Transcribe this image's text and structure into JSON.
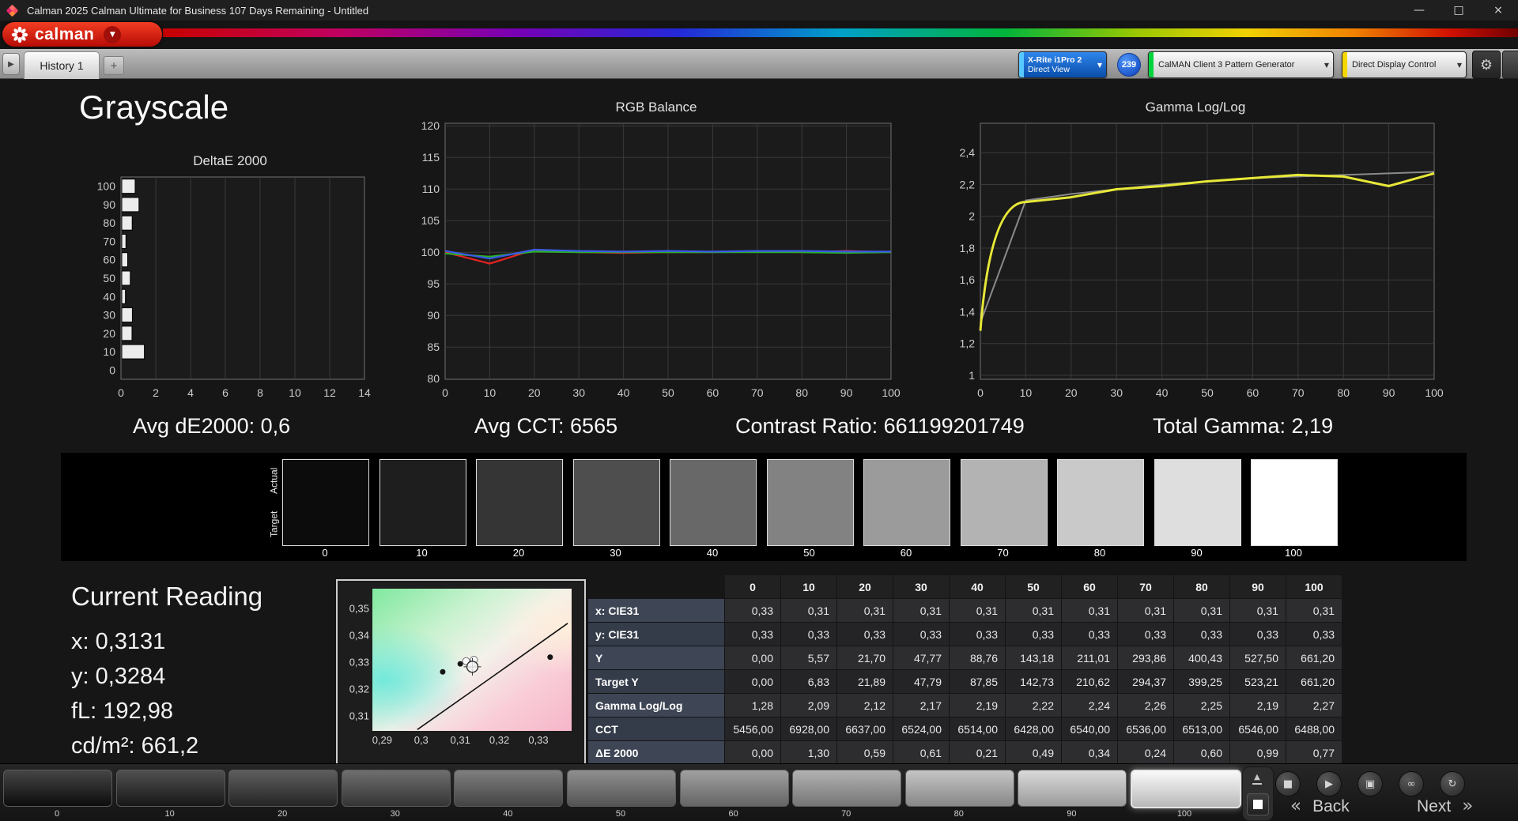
{
  "titlebar": {
    "title": "Calman 2025 Calman Ultimate for Business 107 Days Remaining  - Untitled"
  },
  "ui": {
    "minimize": "—",
    "maximize": "□",
    "close": "×",
    "dropdown_arrow": "▼",
    "nav_arrow": "▶",
    "gear": "⚙",
    "eject": "▲",
    "back_arrow": "«",
    "next_arrow": "»"
  },
  "logo": {
    "brand": "calman"
  },
  "tabbar": {
    "history_tab": "History 1",
    "add_tab": "+",
    "meter_button": {
      "line1": "X-Rite i1Pro 2",
      "line2": "Direct View"
    },
    "meter_badge": "239",
    "pattern_button": "CalMAN Client 3 Pattern Generator",
    "display_button": "Direct Display Control"
  },
  "page": {
    "title": "Grayscale"
  },
  "stats": [
    "Avg dE2000: 0,6",
    "Avg CCT: 6565",
    "Contrast Ratio: 661199201749",
    "Total Gamma: 2,19"
  ],
  "chart_data": [
    {
      "type": "bar",
      "orientation": "horizontal",
      "title": "DeltaE 2000",
      "categories": [
        "100",
        "90",
        "80",
        "70",
        "60",
        "50",
        "40",
        "30",
        "20",
        "10",
        "0"
      ],
      "values": [
        0.77,
        0.99,
        0.6,
        0.24,
        0.34,
        0.49,
        0.21,
        0.61,
        0.59,
        1.3,
        0.0
      ],
      "xlim": [
        0,
        14
      ],
      "xticks": [
        0,
        2,
        4,
        6,
        8,
        10,
        12,
        14
      ],
      "bar_color": "#ececec",
      "grid": true,
      "legend": "none"
    },
    {
      "type": "line",
      "title": "RGB Balance",
      "x": [
        0,
        10,
        20,
        30,
        40,
        50,
        60,
        70,
        80,
        90,
        100
      ],
      "xticks": [
        0,
        10,
        20,
        30,
        40,
        50,
        60,
        70,
        80,
        90,
        100
      ],
      "ylim": [
        79.9,
        120.4
      ],
      "yticks": [
        80,
        85,
        90,
        95,
        100,
        105,
        110,
        115,
        120
      ],
      "grid": true,
      "legend": "none",
      "series": [
        {
          "name": "red-balance",
          "color": "#e82222",
          "width": 2.2,
          "values": [
            100,
            98.2,
            100.4,
            100,
            99.9,
            100,
            100,
            100.1,
            100,
            100.2,
            100
          ]
        },
        {
          "name": "green-balance",
          "color": "#28b028",
          "width": 2.2,
          "values": [
            99.8,
            99.3,
            100.1,
            100,
            100,
            100,
            100,
            100,
            100,
            99.9,
            100
          ]
        },
        {
          "name": "blue-balance",
          "color": "#3a5ae8",
          "width": 2.2,
          "values": [
            100.2,
            99.0,
            100.4,
            100.2,
            100.1,
            100.2,
            100.1,
            100.2,
            100.2,
            100.1,
            100.1
          ]
        }
      ]
    },
    {
      "type": "line",
      "title": "Gamma Log/Log",
      "x": [
        0,
        10,
        20,
        30,
        40,
        50,
        60,
        70,
        80,
        90,
        100
      ],
      "xticks": [
        0,
        10,
        20,
        30,
        40,
        50,
        60,
        70,
        80,
        90,
        100
      ],
      "ylim": [
        0.975,
        2.585
      ],
      "yticks": [
        1,
        1.2,
        1.4,
        1.6,
        1.8,
        2,
        2.2,
        2.4
      ],
      "ytick_labels": [
        "1",
        "1,2",
        "1,4",
        "1,6",
        "1,8",
        "2",
        "2,2",
        "2,4"
      ],
      "grid": true,
      "legend": "none",
      "series": [
        {
          "name": "gamma-reference",
          "color": "#8a8a8a",
          "width": 2,
          "values": [
            1.33,
            2.1,
            2.14,
            2.17,
            2.2,
            2.22,
            2.24,
            2.25,
            2.26,
            2.27,
            2.28
          ]
        },
        {
          "name": "gamma-measured",
          "color": "#e8e838",
          "width": 3,
          "knee": true,
          "values": [
            1.28,
            2.09,
            2.12,
            2.17,
            2.19,
            2.22,
            2.24,
            2.26,
            2.25,
            2.19,
            2.27
          ]
        }
      ]
    }
  ],
  "swatch_strip": {
    "actual_label": "Actual",
    "target_label": "Target",
    "levels": [
      "0",
      "10",
      "20",
      "30",
      "40",
      "50",
      "60",
      "70",
      "80",
      "90",
      "100"
    ],
    "colors": [
      "#0c0c0c",
      "#1e1e1e",
      "#353535",
      "#4e4e4e",
      "#686868",
      "#828282",
      "#9b9b9b",
      "#b3b3b3",
      "#c9c9c9",
      "#dedede",
      "#ffffff"
    ]
  },
  "current_reading": {
    "title": "Current Reading",
    "lines": [
      "x: 0,3131",
      "y: 0,3284",
      "fL: 192,98",
      "cd/m²: 661,2"
    ]
  },
  "cie": {
    "xlim": [
      0.2875,
      0.3385
    ],
    "ylim": [
      0.3045,
      0.3575
    ],
    "xticks": [
      "0,29",
      "0,3",
      "0,31",
      "0,32",
      "0,33"
    ],
    "xtick_vals": [
      0.29,
      0.3,
      0.31,
      0.32,
      0.33
    ],
    "yticks": [
      "0,35",
      "0,34",
      "0,33",
      "0,32",
      "0,31"
    ],
    "ytick_vals": [
      0.35,
      0.34,
      0.33,
      0.32,
      0.31
    ],
    "locus": [
      [
        0.299,
        0.305
      ],
      [
        0.3157,
        0.3221
      ],
      [
        0.3375,
        0.3446
      ]
    ],
    "measured_points": [
      [
        0.3055,
        0.3265
      ],
      [
        0.31,
        0.3295
      ],
      [
        0.3125,
        0.33
      ],
      [
        0.333,
        0.332
      ]
    ],
    "target_points": [
      [
        0.3115,
        0.3305
      ],
      [
        0.3135,
        0.331
      ],
      [
        0.3128,
        0.3292
      ]
    ],
    "current_point": [
      0.3131,
      0.3284
    ]
  },
  "table": {
    "columns": [
      "",
      "0",
      "10",
      "20",
      "30",
      "40",
      "50",
      "60",
      "70",
      "80",
      "90",
      "100"
    ],
    "rows": [
      {
        "label": "x: CIE31",
        "values": [
          "0,33",
          "0,31",
          "0,31",
          "0,31",
          "0,31",
          "0,31",
          "0,31",
          "0,31",
          "0,31",
          "0,31",
          "0,31"
        ]
      },
      {
        "label": "y: CIE31",
        "values": [
          "0,33",
          "0,33",
          "0,33",
          "0,33",
          "0,33",
          "0,33",
          "0,33",
          "0,33",
          "0,33",
          "0,33",
          "0,33"
        ]
      },
      {
        "label": "Y",
        "values": [
          "0,00",
          "5,57",
          "21,70",
          "47,77",
          "88,76",
          "143,18",
          "211,01",
          "293,86",
          "400,43",
          "527,50",
          "661,20"
        ]
      },
      {
        "label": "Target Y",
        "values": [
          "0,00",
          "6,83",
          "21,89",
          "47,79",
          "87,85",
          "142,73",
          "210,62",
          "294,37",
          "399,25",
          "523,21",
          "661,20"
        ]
      },
      {
        "label": "Gamma Log/Log",
        "values": [
          "1,28",
          "2,09",
          "2,12",
          "2,17",
          "2,19",
          "2,22",
          "2,24",
          "2,26",
          "2,25",
          "2,19",
          "2,27"
        ]
      },
      {
        "label": "CCT",
        "values": [
          "5456,00",
          "6928,00",
          "6637,00",
          "6524,00",
          "6514,00",
          "6428,00",
          "6540,00",
          "6536,00",
          "6513,00",
          "6546,00",
          "6488,00"
        ]
      },
      {
        "label": "ΔE 2000",
        "values": [
          "0,00",
          "1,30",
          "0,59",
          "0,61",
          "0,21",
          "0,49",
          "0,34",
          "0,24",
          "0,60",
          "0,99",
          "0,77"
        ]
      }
    ]
  },
  "toolbar": {
    "patches": [
      {
        "label": "0",
        "color": "#111111"
      },
      {
        "label": "10",
        "color": "#1f1f1f"
      },
      {
        "label": "20",
        "color": "#313131"
      },
      {
        "label": "30",
        "color": "#464646"
      },
      {
        "label": "40",
        "color": "#5b5b5b"
      },
      {
        "label": "50",
        "color": "#707070"
      },
      {
        "label": "60",
        "color": "#868686"
      },
      {
        "label": "70",
        "color": "#9d9d9d"
      },
      {
        "label": "80",
        "color": "#b5b5b5"
      },
      {
        "label": "90",
        "color": "#cfcfcf"
      },
      {
        "label": "100",
        "color": "#f7f7f7"
      }
    ],
    "selected_patch": "100",
    "back_label": "Back",
    "next_label": "Next"
  },
  "transport": {
    "buttons": [
      {
        "name": "stop-button",
        "glyph": "■"
      },
      {
        "name": "play-button",
        "glyph": "▶"
      },
      {
        "name": "save-button",
        "glyph": "▣"
      },
      {
        "name": "continuous-button",
        "glyph": "∞"
      },
      {
        "name": "loop-button",
        "glyph": "↻"
      }
    ]
  }
}
